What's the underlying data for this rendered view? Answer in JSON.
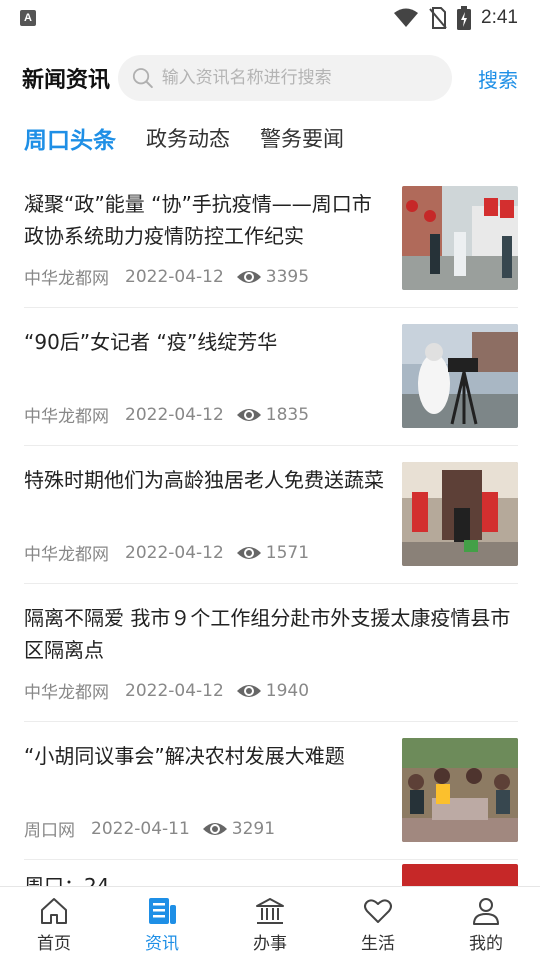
{
  "status_bar": {
    "time": "2:41",
    "notification_badge": "A"
  },
  "header": {
    "title": "新闻资讯",
    "search_placeholder": "输入资讯名称进行搜索",
    "search_button": "搜索"
  },
  "tabs": [
    {
      "label": "周口头条",
      "active": true
    },
    {
      "label": "政务动态",
      "active": false
    },
    {
      "label": "警务要闻",
      "active": false
    }
  ],
  "news": [
    {
      "title": "凝聚“政”能量 “协”手抗疫情——周口市政协系统助力疫情防控工作纪实",
      "source": "中华龙都网",
      "date": "2022-04-12",
      "views": "3395",
      "has_image": true
    },
    {
      "title": "“90后”女记者 “疫”线绽芳华",
      "source": "中华龙都网",
      "date": "2022-04-12",
      "views": "1835",
      "has_image": true
    },
    {
      "title": "特殊时期他们为高龄独居老人免费送蔬菜",
      "source": "中华龙都网",
      "date": "2022-04-12",
      "views": "1571",
      "has_image": true
    },
    {
      "title": "隔离不隔爱 我市９个工作组分赴市外支援太康疫情县市区隔离点",
      "source": "中华龙都网",
      "date": "2022-04-12",
      "views": "1940",
      "has_image": false
    },
    {
      "title": "“小胡同议事会”解决农村发展大难题",
      "source": "周口网",
      "date": "2022-04-11",
      "views": "3291",
      "has_image": true
    },
    {
      "title": "周口：24",
      "partial": true
    }
  ],
  "bottom_nav": [
    {
      "label": "首页",
      "icon": "home-icon",
      "active": false
    },
    {
      "label": "资讯",
      "icon": "news-icon",
      "active": true
    },
    {
      "label": "办事",
      "icon": "government-building-icon",
      "active": false
    },
    {
      "label": "生活",
      "icon": "heart-icon",
      "active": false
    },
    {
      "label": "我的",
      "icon": "user-icon",
      "active": false
    }
  ],
  "colors": {
    "accent": "#1e8fe6",
    "text": "#222222",
    "meta": "#888888"
  }
}
